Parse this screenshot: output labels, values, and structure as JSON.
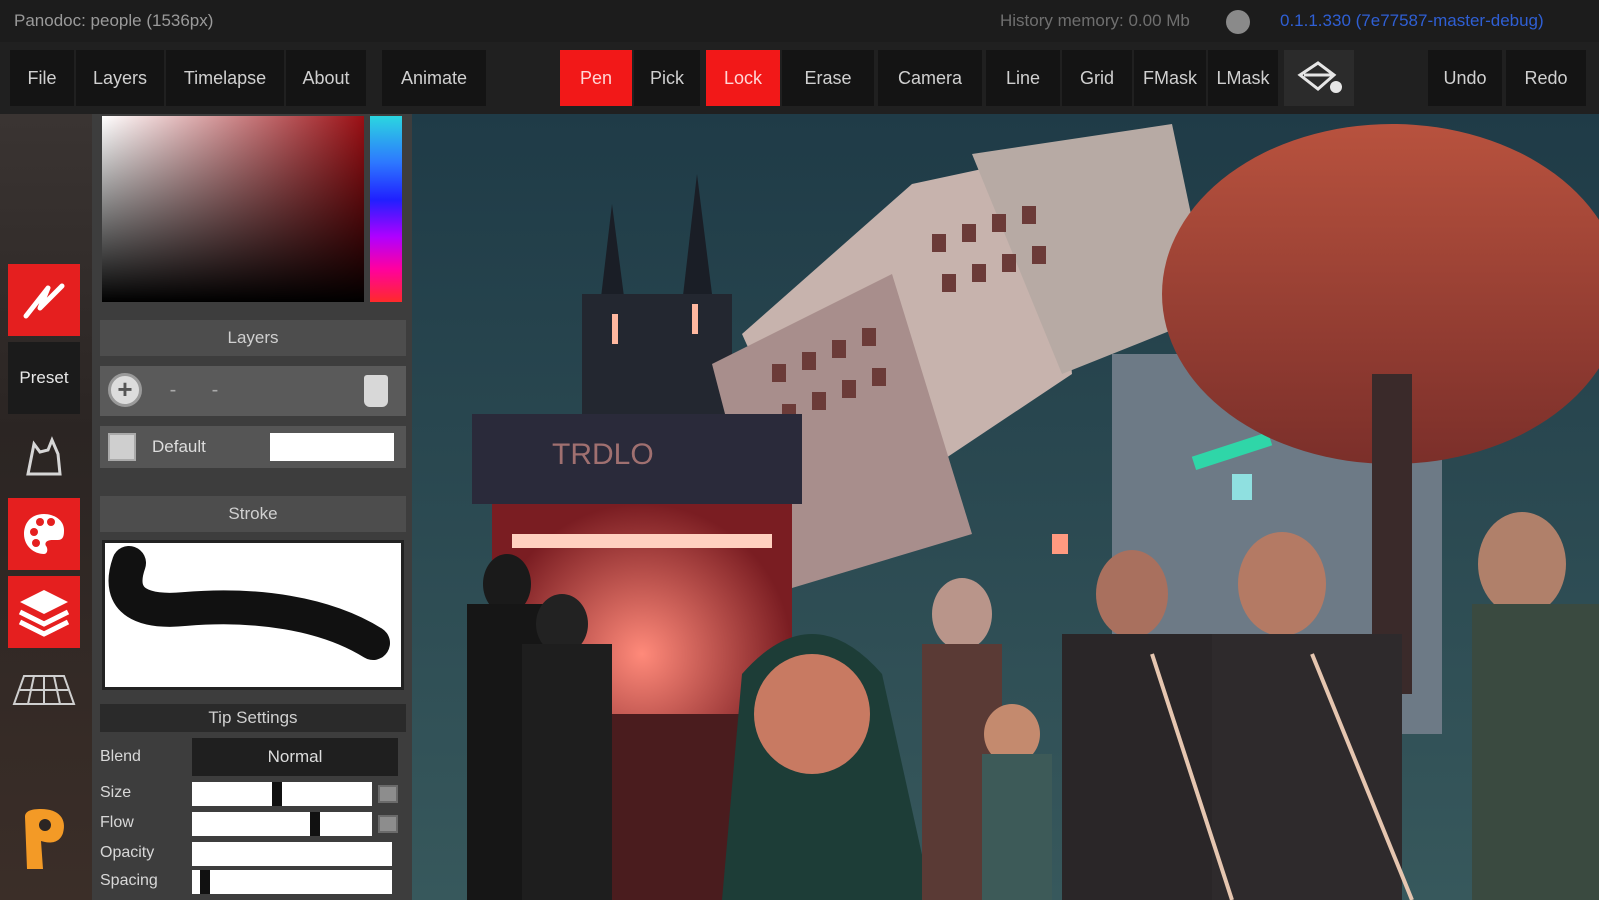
{
  "titlebar": {
    "app_title": "Panodoc: people (1536px)",
    "history_memory": "History memory: 0.00 Mb",
    "version": "0.1.1.330 (7e77587-master-debug)"
  },
  "toolbar": {
    "file": "File",
    "layers": "Layers",
    "timelapse": "Timelapse",
    "about": "About",
    "animate": "Animate",
    "pen": "Pen",
    "pick": "Pick",
    "lock": "Lock",
    "erase": "Erase",
    "camera": "Camera",
    "line": "Line",
    "grid": "Grid",
    "fmask": "FMask",
    "lmask": "LMask",
    "undo": "Undo",
    "redo": "Redo",
    "active_tools": [
      "Pen",
      "Lock"
    ],
    "active_color": "#f21818"
  },
  "leftcol": {
    "preset": "Preset",
    "icons": [
      "brush-icon",
      "preset",
      "cat-sketch-icon",
      "palette-icon",
      "layers-stack-icon",
      "perspective-grid-icon",
      "app-logo-icon"
    ]
  },
  "panel": {
    "layers_header": "Layers",
    "layer_name": "Default",
    "stroke_header": "Stroke",
    "tip_header": "Tip Settings",
    "blend_label": "Blend",
    "blend_value": "Normal",
    "size_label": "Size",
    "flow_label": "Flow",
    "opacity_label": "Opacity",
    "spacing_label": "Spacing"
  },
  "colors": {
    "current_hue": "#9a0f14"
  },
  "canvas": {
    "sign_text": "TRDLO"
  }
}
